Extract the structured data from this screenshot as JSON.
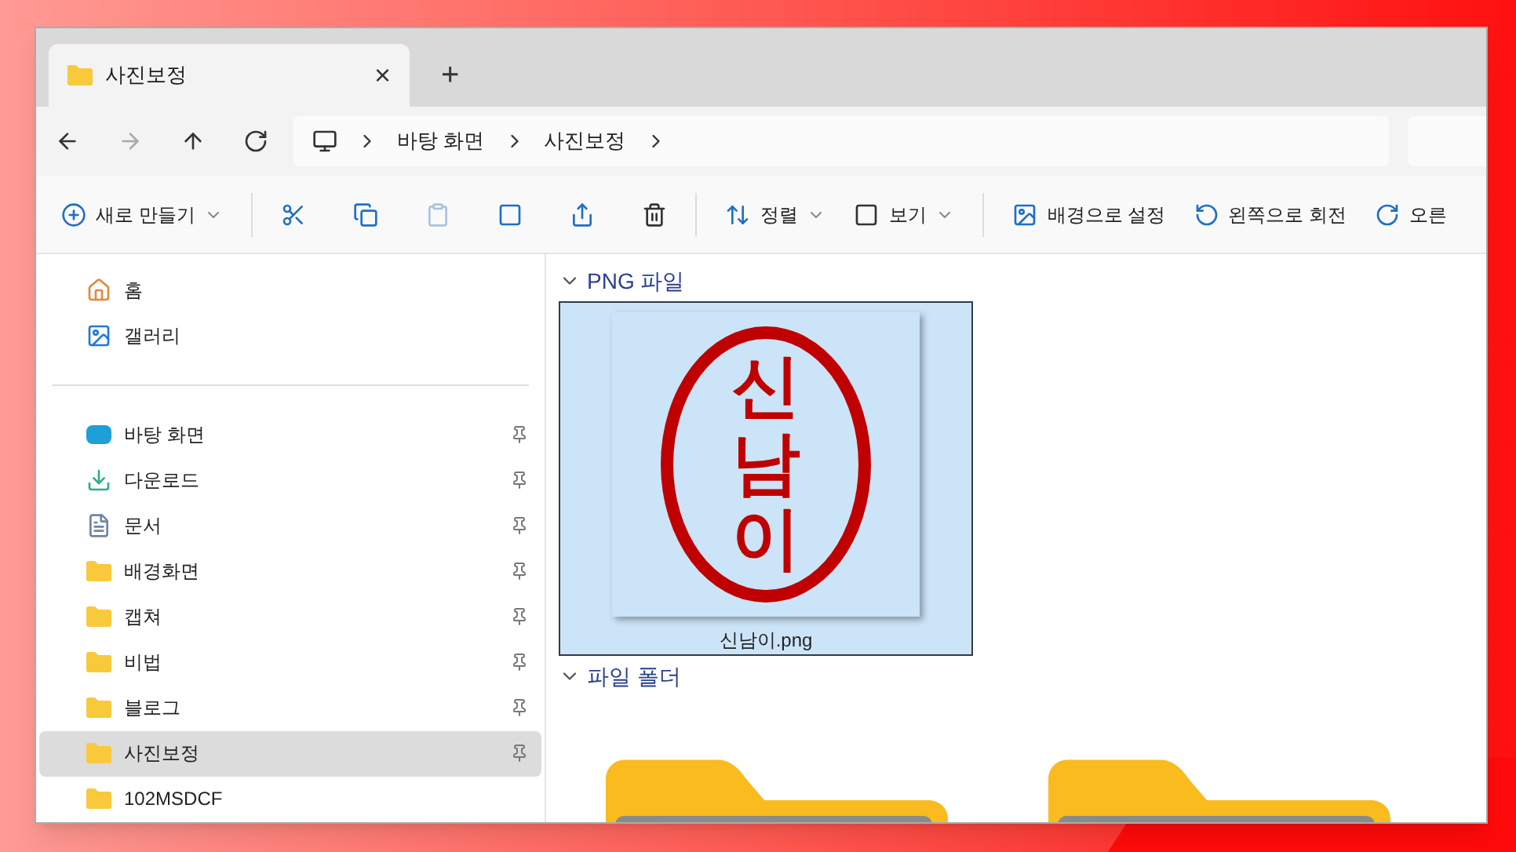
{
  "window": {
    "tab": {
      "title": "사진보정",
      "close": "×"
    },
    "new_tab": "+"
  },
  "address_bar": {
    "crumbs": [
      "바탕 화면",
      "사진보정"
    ]
  },
  "toolbar": {
    "new": "새로 만들기",
    "sort": "정렬",
    "view": "보기",
    "actions": [
      {
        "kind": "wallpaper",
        "label": "배경으로 설정"
      },
      {
        "kind": "rotate-left",
        "label": "왼쪽으로 회전"
      },
      {
        "kind": "rotate-right",
        "label": "오른"
      }
    ]
  },
  "sidebar": {
    "top": [
      {
        "kind": "home",
        "label": "홈"
      },
      {
        "kind": "gallery",
        "label": "갤러리"
      }
    ],
    "items": [
      {
        "kind": "desktop",
        "label": "바탕 화면",
        "selected": false
      },
      {
        "kind": "download",
        "label": "다운로드",
        "selected": false
      },
      {
        "kind": "document",
        "label": "문서",
        "selected": false
      },
      {
        "kind": "folder",
        "label": "배경화면",
        "selected": false
      },
      {
        "kind": "folder",
        "label": "캡쳐",
        "selected": false
      },
      {
        "kind": "folder",
        "label": "비법",
        "selected": false
      },
      {
        "kind": "folder",
        "label": "블로그",
        "selected": false
      },
      {
        "kind": "folder",
        "label": "사진보정",
        "selected": true
      },
      {
        "kind": "folder",
        "label": "102MSDCF",
        "selected": false
      }
    ]
  },
  "groups": [
    {
      "title": "PNG 파일",
      "files": [
        {
          "name": "신남이.png",
          "stamp_text": "신남이",
          "selected": true
        }
      ]
    },
    {
      "title": "파일 폴더",
      "folders": [
        {
          "selected": false
        },
        {
          "selected": false
        }
      ]
    }
  ]
}
